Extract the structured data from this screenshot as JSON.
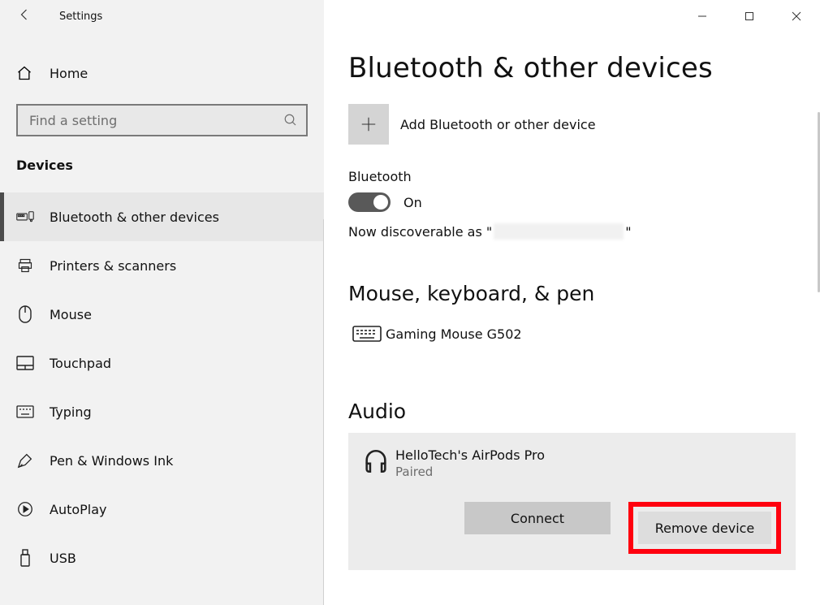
{
  "window": {
    "title": "Settings"
  },
  "sidebar": {
    "home_label": "Home",
    "search_placeholder": "Find a setting",
    "category": "Devices",
    "items": [
      {
        "label": "Bluetooth & other devices",
        "icon": "bluetooth-devices-icon",
        "selected": true
      },
      {
        "label": "Printers & scanners",
        "icon": "printer-icon",
        "selected": false
      },
      {
        "label": "Mouse",
        "icon": "mouse-icon",
        "selected": false
      },
      {
        "label": "Touchpad",
        "icon": "touchpad-icon",
        "selected": false
      },
      {
        "label": "Typing",
        "icon": "keyboard-icon",
        "selected": false
      },
      {
        "label": "Pen & Windows Ink",
        "icon": "pen-icon",
        "selected": false
      },
      {
        "label": "AutoPlay",
        "icon": "autoplay-icon",
        "selected": false
      },
      {
        "label": "USB",
        "icon": "usb-icon",
        "selected": false
      }
    ]
  },
  "main": {
    "page_title": "Bluetooth & other devices",
    "add_device_label": "Add Bluetooth or other device",
    "bluetooth": {
      "heading": "Bluetooth",
      "state_label": "On",
      "state_on": true,
      "discoverable_prefix": "Now discoverable as \"",
      "discoverable_suffix": "\""
    },
    "mouse_keyboard_pen": {
      "heading": "Mouse, keyboard, & pen",
      "devices": [
        {
          "name": "Gaming Mouse G502",
          "icon": "keyboard-device-icon"
        }
      ]
    },
    "audio": {
      "heading": "Audio",
      "selected_device": {
        "name": "HelloTech's AirPods Pro",
        "status": "Paired",
        "icon": "headphones-icon",
        "connect_label": "Connect",
        "remove_label": "Remove device"
      }
    }
  }
}
